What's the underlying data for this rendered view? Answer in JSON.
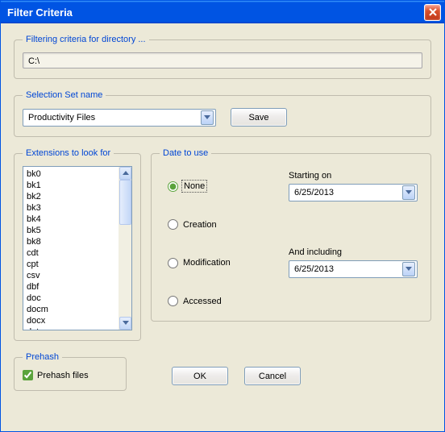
{
  "window": {
    "title": "Filter Criteria"
  },
  "filtering": {
    "legend": "Filtering criteria for directory ...",
    "path": "C:\\"
  },
  "selection_set": {
    "legend": "Selection Set name",
    "value": "Productivity Files",
    "save_label": "Save"
  },
  "extensions": {
    "legend": "Extensions to look for",
    "items": [
      "bk0",
      "bk1",
      "bk2",
      "bk3",
      "bk4",
      "bk5",
      "bk8",
      "cdt",
      "cpt",
      "csv",
      "dbf",
      "doc",
      "docm",
      "docx",
      "dot"
    ]
  },
  "date": {
    "legend": "Date to use",
    "options": {
      "none": "None",
      "creation": "Creation",
      "modification": "Modification",
      "accessed": "Accessed"
    },
    "selected": "none",
    "start_label": "Starting on",
    "start_value": "6/25/2013",
    "include_label": "And including",
    "include_value": "6/25/2013"
  },
  "prehash": {
    "legend": "Prehash",
    "label": "Prehash files",
    "checked": true
  },
  "buttons": {
    "ok": "OK",
    "cancel": "Cancel"
  }
}
